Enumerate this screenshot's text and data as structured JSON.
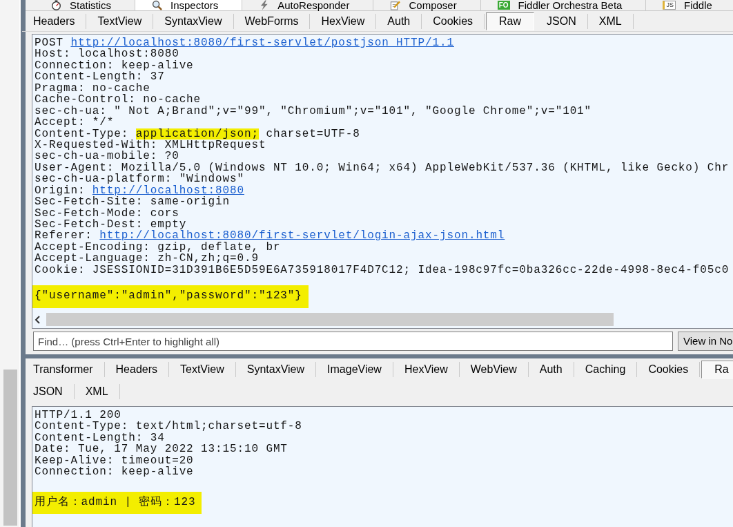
{
  "main_tabs": [
    {
      "label": "Statistics",
      "selected": false
    },
    {
      "label": "Inspectors",
      "selected": true
    },
    {
      "label": "AutoResponder",
      "selected": false
    },
    {
      "label": "Composer",
      "selected": false
    },
    {
      "label": "Fiddler Orchestra Beta",
      "selected": false,
      "logo_text": "FO"
    },
    {
      "label": "Fiddle",
      "selected": false,
      "logo_text": "JS"
    }
  ],
  "request": {
    "tabs": [
      {
        "label": "Headers",
        "selected": false
      },
      {
        "label": "TextView",
        "selected": false
      },
      {
        "label": "SyntaxView",
        "selected": false
      },
      {
        "label": "WebForms",
        "selected": false
      },
      {
        "label": "HexView",
        "selected": false
      },
      {
        "label": "Auth",
        "selected": false
      },
      {
        "label": "Cookies",
        "selected": false
      },
      {
        "label": "Raw",
        "selected": true
      },
      {
        "label": "JSON",
        "selected": false
      },
      {
        "label": "XML",
        "selected": false
      }
    ],
    "headers": [
      {
        "parts": [
          {
            "kind": "text",
            "text": "POST ",
            "highlighted": false
          },
          {
            "kind": "link",
            "text": "http://localhost:8080/first-servlet/postjson HTTP/1.1",
            "highlighted": false
          }
        ]
      },
      {
        "parts": [
          {
            "kind": "text",
            "text": "Host: localhost:8080",
            "highlighted": false
          }
        ]
      },
      {
        "parts": [
          {
            "kind": "text",
            "text": "Connection: keep-alive",
            "highlighted": false
          }
        ]
      },
      {
        "parts": [
          {
            "kind": "text",
            "text": "Content-Length: 37",
            "highlighted": false
          }
        ]
      },
      {
        "parts": [
          {
            "kind": "text",
            "text": "Pragma: no-cache",
            "highlighted": false
          }
        ]
      },
      {
        "parts": [
          {
            "kind": "text",
            "text": "Cache-Control: no-cache",
            "highlighted": false
          }
        ]
      },
      {
        "parts": [
          {
            "kind": "text",
            "text": "sec-ch-ua: \" Not A;Brand\";v=\"99\", \"Chromium\";v=\"101\", \"Google Chrome\";v=\"101\"",
            "highlighted": false
          }
        ]
      },
      {
        "parts": [
          {
            "kind": "text",
            "text": "Accept: */*",
            "highlighted": false
          }
        ]
      },
      {
        "parts": [
          {
            "kind": "text",
            "text": "Content-Type: ",
            "highlighted": false
          },
          {
            "kind": "text",
            "text": "application/json;",
            "highlighted": true
          },
          {
            "kind": "text",
            "text": " charset=UTF-8",
            "highlighted": false
          }
        ]
      },
      {
        "parts": [
          {
            "kind": "text",
            "text": "X-Requested-With: XMLHttpRequest",
            "highlighted": false
          }
        ]
      },
      {
        "parts": [
          {
            "kind": "text",
            "text": "sec-ch-ua-mobile: ?0",
            "highlighted": false
          }
        ]
      },
      {
        "parts": [
          {
            "kind": "text",
            "text": "User-Agent: Mozilla/5.0 (Windows NT 10.0; Win64; x64) AppleWebKit/537.36 (KHTML, like Gecko) Chr",
            "highlighted": false
          }
        ]
      },
      {
        "parts": [
          {
            "kind": "text",
            "text": "sec-ch-ua-platform: \"Windows\"",
            "highlighted": false
          }
        ]
      },
      {
        "parts": [
          {
            "kind": "text",
            "text": "Origin: ",
            "highlighted": false
          },
          {
            "kind": "link",
            "text": "http://localhost:8080",
            "highlighted": false
          }
        ]
      },
      {
        "parts": [
          {
            "kind": "text",
            "text": "Sec-Fetch-Site: same-origin",
            "highlighted": false
          }
        ]
      },
      {
        "parts": [
          {
            "kind": "text",
            "text": "Sec-Fetch-Mode: cors",
            "highlighted": false
          }
        ]
      },
      {
        "parts": [
          {
            "kind": "text",
            "text": "Sec-Fetch-Dest: empty",
            "highlighted": false
          }
        ]
      },
      {
        "parts": [
          {
            "kind": "text",
            "text": "Referer: ",
            "highlighted": false
          },
          {
            "kind": "link",
            "text": "http://localhost:8080/first-servlet/login-ajax-json.html",
            "highlighted": false
          }
        ]
      },
      {
        "parts": [
          {
            "kind": "text",
            "text": "Accept-Encoding: gzip, deflate, br",
            "highlighted": false
          }
        ]
      },
      {
        "parts": [
          {
            "kind": "text",
            "text": "Accept-Language: zh-CN,zh;q=0.9",
            "highlighted": false
          }
        ]
      },
      {
        "parts": [
          {
            "kind": "text",
            "text": "Cookie: JSESSIONID=31D391B6E5D59E6A735918017F4D7C12; Idea-198c97fc=0ba326cc-22de-4998-8ec4-f05c0",
            "highlighted": false
          }
        ]
      }
    ],
    "body": {
      "text": "{\"username\":\"admin\",\"password\":\"123\"}",
      "highlighted": true
    },
    "find": {
      "placeholder": "Find… (press Ctrl+Enter to highlight all)"
    },
    "view_button": "View in No"
  },
  "response": {
    "tab_rows": [
      {
        "tabs": [
          {
            "label": "Transformer",
            "selected": false
          },
          {
            "label": "Headers",
            "selected": false
          },
          {
            "label": "TextView",
            "selected": false
          },
          {
            "label": "SyntaxView",
            "selected": false
          },
          {
            "label": "ImageView",
            "selected": false
          },
          {
            "label": "HexView",
            "selected": false
          },
          {
            "label": "WebView",
            "selected": false
          },
          {
            "label": "Auth",
            "selected": false
          },
          {
            "label": "Caching",
            "selected": false
          },
          {
            "label": "Cookies",
            "selected": false
          },
          {
            "label": "Ra",
            "selected": true
          }
        ]
      },
      {
        "tabs": [
          {
            "label": "JSON",
            "selected": false
          },
          {
            "label": "XML",
            "selected": false
          }
        ]
      }
    ],
    "headers": [
      {
        "parts": [
          {
            "kind": "text",
            "text": "HTTP/1.1 200",
            "highlighted": false
          }
        ]
      },
      {
        "parts": [
          {
            "kind": "text",
            "text": "Content-Type: text/html;charset=utf-8",
            "highlighted": false
          }
        ]
      },
      {
        "parts": [
          {
            "kind": "text",
            "text": "Content-Length: 34",
            "highlighted": false
          }
        ]
      },
      {
        "parts": [
          {
            "kind": "text",
            "text": "Date: Tue, 17 May 2022 13:15:10 GMT",
            "highlighted": false
          }
        ]
      },
      {
        "parts": [
          {
            "kind": "text",
            "text": "Keep-Alive: timeout=20",
            "highlighted": false
          }
        ]
      },
      {
        "parts": [
          {
            "kind": "text",
            "text": "Connection: keep-alive",
            "highlighted": false
          }
        ]
      }
    ],
    "body": {
      "text": "用户名：admin | 密码：123",
      "highlighted": true
    }
  }
}
